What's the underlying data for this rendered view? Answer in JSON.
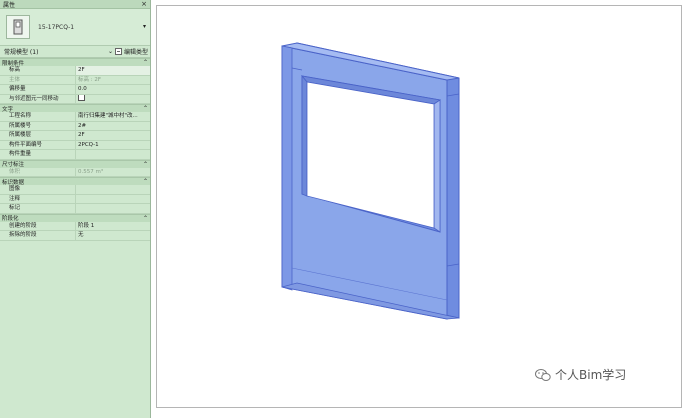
{
  "panel": {
    "title": "属性",
    "close_label": "×",
    "type_name": "15-17PCQ-1",
    "selector_label": "常规模型 (1)",
    "edit_type_label": "编辑类型",
    "sections": [
      {
        "title": "限制条件",
        "rows": [
          {
            "k": "标高",
            "v": "2F",
            "boxed": true
          },
          {
            "k": "主体",
            "v": "标高 : 2F",
            "disabled": true
          },
          {
            "k": "偏移量",
            "v": "0.0"
          },
          {
            "k": "与邻近图元一同移动",
            "v": "",
            "checkbox": true
          }
        ]
      },
      {
        "title": "文字",
        "rows": [
          {
            "k": "工程名称",
            "v": "南行归集建\"城中村\"改..."
          },
          {
            "k": "所属楼号",
            "v": "2#"
          },
          {
            "k": "所属楼层",
            "v": "2F"
          },
          {
            "k": "构件平面编号",
            "v": "2PCQ-1"
          },
          {
            "k": "构件重量",
            "v": ""
          }
        ]
      },
      {
        "title": "尺寸标注",
        "rows": [
          {
            "k": "体积",
            "v": "0.557 m³",
            "disabled": true
          }
        ]
      },
      {
        "title": "标识数据",
        "rows": [
          {
            "k": "图像",
            "v": ""
          },
          {
            "k": "注释",
            "v": ""
          },
          {
            "k": "标记",
            "v": ""
          }
        ]
      },
      {
        "title": "阶段化",
        "rows": [
          {
            "k": "创建的阶段",
            "v": "阶段 1"
          },
          {
            "k": "拆除的阶段",
            "v": "无"
          }
        ]
      }
    ]
  },
  "watermark": {
    "text": "个人Bim学习",
    "icon": "wechat-icon"
  },
  "colors": {
    "panel_bg": "#cfe8cf",
    "model_fill": "#8aa6ea",
    "model_stroke": "#4a63c8"
  }
}
